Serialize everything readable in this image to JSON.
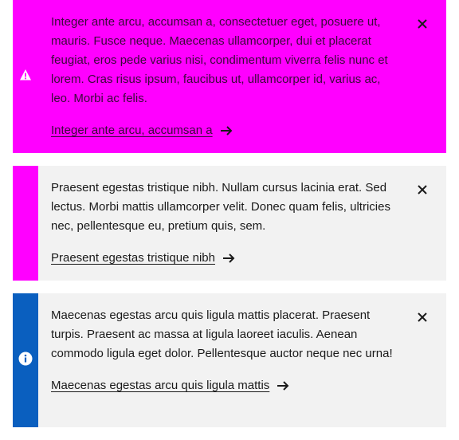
{
  "notices": [
    {
      "variant": "warning",
      "rail_color": "#ff00ff",
      "icon": "warning-icon",
      "message": "Integer ante arcu, accumsan a, consectetuer eget, posuere ut, mauris. Fusce neque. Maecenas ullamcorper, dui et placerat feugiat, eros pede varius nisi, condimentum viverra felis nunc et lorem. Cras risus ipsum, faucibus ut, ullamcorper id, varius ac, leo. Morbi ac felis.",
      "link_label": "Integer ante arcu, accumsan a",
      "close_icon": "close-icon"
    },
    {
      "variant": "error",
      "rail_color": "#ff00ff",
      "message": "Praesent egestas tristique nibh. Nullam cursus lacinia erat. Sed lectus. Morbi mattis ullamcorper velit. Donec quam felis, ultricies nec, pellentesque eu, pretium quis, sem.",
      "link_label": "Praesent egestas tristique nibh",
      "close_icon": "close-icon"
    },
    {
      "variant": "info",
      "rail_color": "#0a5fbf",
      "icon": "info-icon",
      "message": "Maecenas egestas arcu quis ligula mattis placerat. Praesent turpis. Praesent ac massa at ligula laoreet iaculis. Aenean commodo ligula eget dolor. Pellentesque auctor neque nec urna!",
      "link_label": "Maecenas egestas arcu quis ligula mattis",
      "close_icon": "close-icon"
    }
  ]
}
